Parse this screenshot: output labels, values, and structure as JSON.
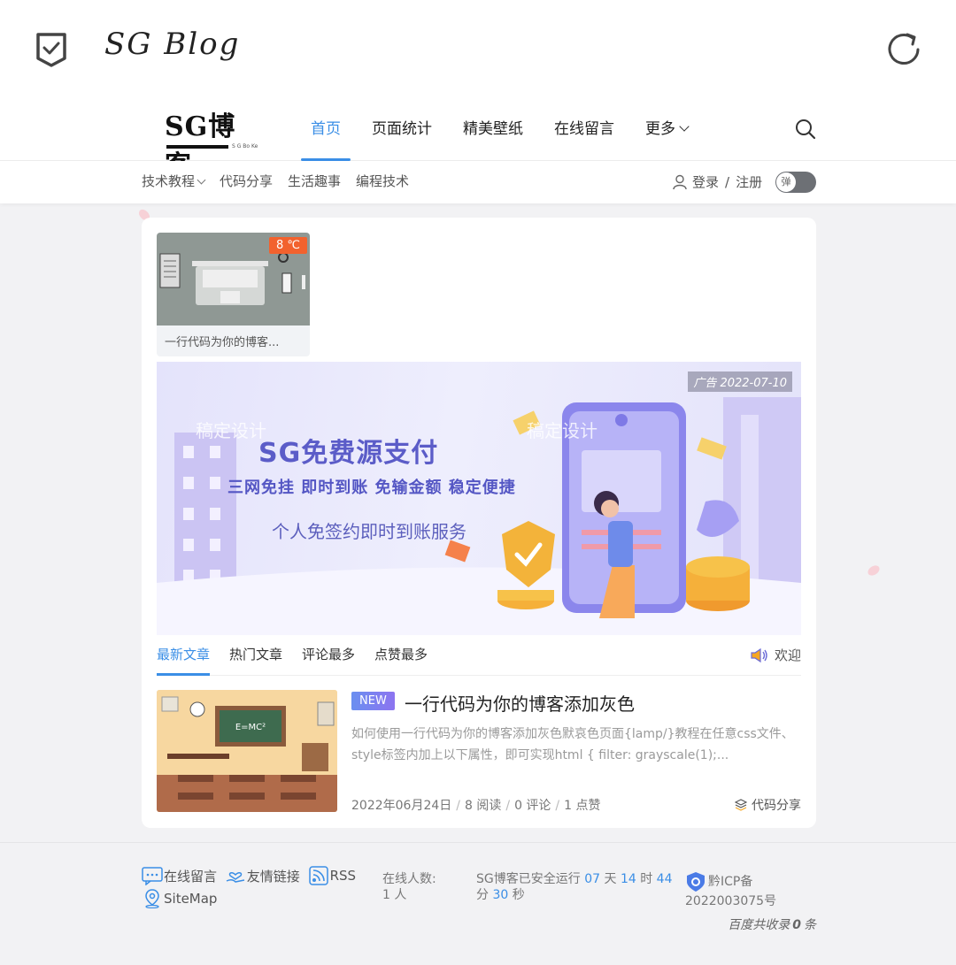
{
  "window": {
    "title": "SG Blog"
  },
  "header": {
    "logo_text": "SG博客",
    "logo_sub": "S G Bo Ke",
    "nav": [
      {
        "label": "首页",
        "active": true
      },
      {
        "label": "页面统计"
      },
      {
        "label": "精美壁纸"
      },
      {
        "label": "在线留言"
      },
      {
        "label": "更多"
      }
    ]
  },
  "subnav": {
    "items": [
      "技术教程",
      "代码分享",
      "生活趣事",
      "编程技术"
    ],
    "login": "登录",
    "divider": "/",
    "register": "注册",
    "toggle_label": "弹"
  },
  "mini_post": {
    "temperature": "8 ℃",
    "title": "一行代码为你的博客..."
  },
  "ad": {
    "tag": "广告 2022-07-10",
    "headline": "SG免费源支付",
    "line2": "三网免挂  即时到账  免输金额  稳定便捷",
    "line3": "个人免签约即时到账服务",
    "watermark": "稿定设计"
  },
  "tabs": [
    "最新文章",
    "热门文章",
    "评论最多",
    "点赞最多"
  ],
  "notice": "欢迎",
  "post": {
    "badge": "NEW",
    "title": "一行代码为你的博客添加灰色",
    "excerpt": "如何使用一行代码为你的博客添加灰色默哀色页面{lamp/}教程在任意css文件、style标签内加上以下属性，即可实现html { filter: grayscale(1);...",
    "date": "2022年06月24日",
    "reads": "8 阅读",
    "comments": "0 评论",
    "likes": "1 点赞",
    "category": "代码分享",
    "blackboard": "E=MC²"
  },
  "footer": {
    "links": [
      "在线留言",
      "友情链接",
      "RSS",
      "SiteMap"
    ],
    "online_label": "在线人数:",
    "online_count": "1 人",
    "runtime_prefix": "SG博客已安全运行",
    "days": "07",
    "days_unit": "天",
    "hours": "14",
    "hours_unit": "时",
    "minutes": "44",
    "minutes_unit": "分",
    "seconds": "30",
    "seconds_unit": "秒",
    "icp_label": "黔ICP备",
    "icp_number": "2022003075号",
    "baidu_prefix": "百度共收录",
    "baidu_count": "0",
    "baidu_suffix": "条"
  },
  "colors": {
    "accent": "#3a8ee6",
    "temp_badge": "#f2622e",
    "ad_text": "#5b5cc8"
  }
}
